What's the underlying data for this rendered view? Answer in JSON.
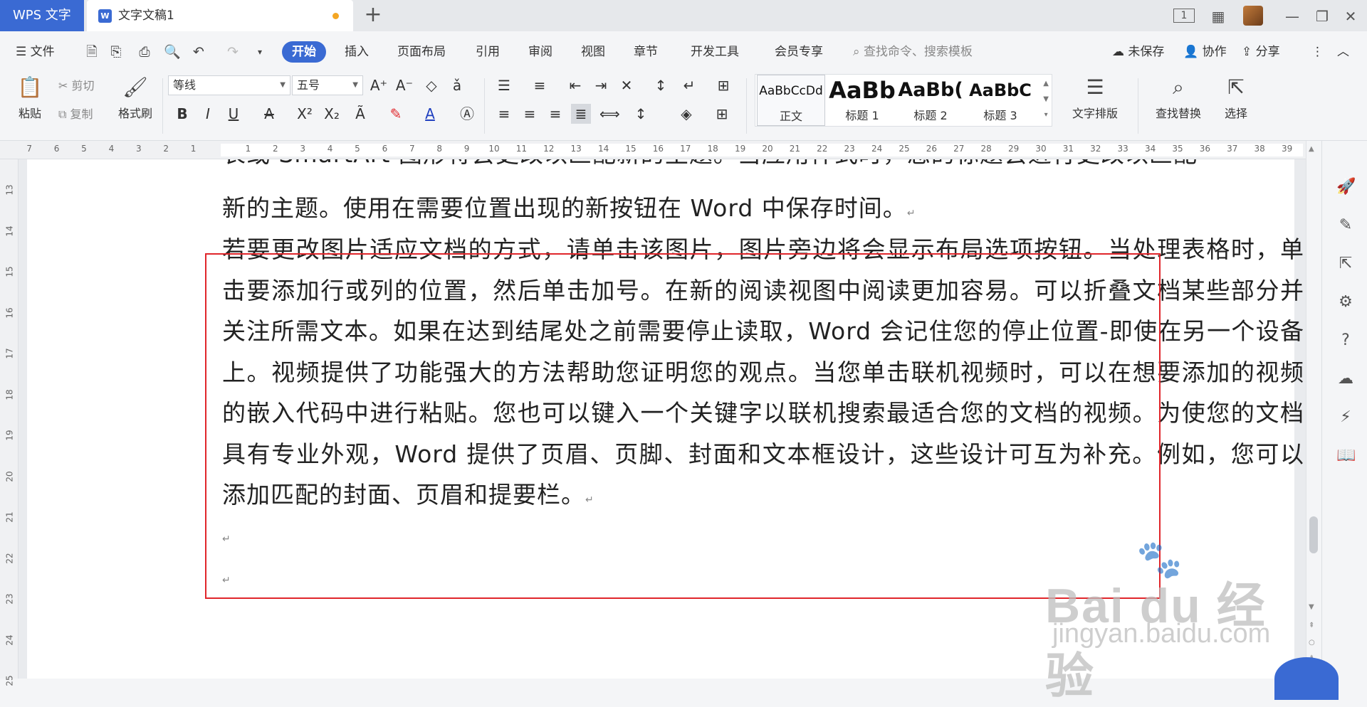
{
  "titlebar": {
    "app_tab": "WPS 文字",
    "doc_tab": "文字文稿1",
    "new_tab_symbol": "+",
    "page_count_badge": "1"
  },
  "menubar": {
    "file": "文件",
    "tabs": [
      "开始",
      "插入",
      "页面布局",
      "引用",
      "审阅",
      "视图",
      "章节",
      "开发工具",
      "会员专享"
    ],
    "active_tab": "开始",
    "search_placeholder": "查找命令、搜索模板",
    "unsaved": "未保存",
    "collaborate": "协作",
    "share": "分享"
  },
  "ribbon": {
    "paste": "粘贴",
    "cut": "剪切",
    "copy": "复制",
    "format_painter": "格式刷",
    "font_name": "等线",
    "font_size": "五号",
    "styles": [
      {
        "preview": "AaBbCcDd",
        "name": "正文"
      },
      {
        "preview": "AaBb",
        "name": "标题 1"
      },
      {
        "preview": "AaBb(",
        "name": "标题 2"
      },
      {
        "preview": "AaBbC",
        "name": "标题 3"
      }
    ],
    "text_layout": "文字排版",
    "find_replace": "查找替换",
    "select": "选择"
  },
  "ruler": {
    "left_numbers": [
      "7",
      "6",
      "5",
      "4",
      "3",
      "2",
      "1"
    ],
    "right_numbers": [
      "1",
      "2",
      "3",
      "4",
      "5",
      "6",
      "7",
      "8",
      "9",
      "10",
      "11",
      "12",
      "13",
      "14",
      "15",
      "16",
      "17",
      "18",
      "19",
      "20",
      "21",
      "22",
      "23",
      "24",
      "25",
      "26",
      "27",
      "28",
      "29",
      "30",
      "31",
      "32",
      "33",
      "34",
      "35",
      "36",
      "37",
      "38",
      "39"
    ],
    "vertical_numbers": [
      "13",
      "14",
      "15",
      "16",
      "17",
      "18",
      "19",
      "20",
      "21",
      "22",
      "23",
      "24",
      "25"
    ]
  },
  "document": {
    "line_partial": "表或 SmartArt 图形将会更改以匹配新的主题。当应用样式时，您的标题会进行更改以匹配",
    "line_top": "新的主题。使用在需要位置出现的新按钮在 Word 中保存时间。",
    "paragraph_main": "若要更改图片适应文档的方式，请单击该图片，图片旁边将会显示布局选项按钮。当处理表格时，单击要添加行或列的位置，然后单击加号。在新的阅读视图中阅读更加容易。可以折叠文档某些部分并关注所需文本。如果在达到结尾处之前需要停止读取，Word 会记住您的停止位置-即使在另一个设备上。视频提供了功能强大的方法帮助您证明您的观点。当您单击联机视频时，可以在想要添加的视频的嵌入代码中进行粘贴。您也可以键入一个关键字以联机搜索最适合您的文档的视频。为使您的文档具有专业外观，Word 提供了页眉、页脚、封面和文本框设计，这些设计可互为补充。例如，您可以添加匹配的封面、页眉和提要栏。",
    "paragraph_mark": "↵"
  },
  "watermark": {
    "logo": "Bai du 经验",
    "url": "jingyan.baidu.com"
  },
  "colors": {
    "accent": "#3a6ad3",
    "highlight_border": "#e0262b",
    "modified_dot": "#f4a623"
  }
}
